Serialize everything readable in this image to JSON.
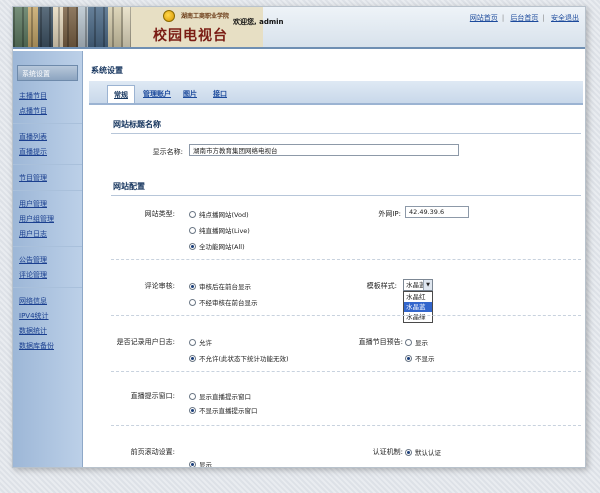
{
  "header": {
    "site_name": "湖南工商职业学院",
    "title": "校园电视台",
    "welcome": "欢迎您, admin",
    "links": [
      "网站首页",
      "后台首页",
      "安全退出"
    ]
  },
  "sidebar": {
    "heading": "系统设置",
    "groups": [
      [
        "主播节目",
        "点播节目"
      ],
      [
        "直播列表",
        "直播提示"
      ],
      [
        "节目管理"
      ],
      [
        "用户管理",
        "用户组管理",
        "用户日志"
      ],
      [
        "公告管理",
        "评论管理"
      ],
      [
        "网络信息",
        "IPV4统计",
        "数据统计",
        "数据库备份"
      ]
    ]
  },
  "main": {
    "title": "系统设置",
    "tabs": [
      "常规",
      "管理账户",
      "图片",
      "接口"
    ],
    "sections": {
      "site_name": "网站标题名称",
      "site_config": "网站配置"
    },
    "fields": {
      "display_name_label": "显示名称:",
      "display_name_value": "湖南市方教育集团网络电视台",
      "site_type_label": "网站类型:",
      "site_type_options": [
        "纯点播网站(Vod)",
        "纯直播网站(Live)",
        "全功能网站(All)"
      ],
      "external_ip_label": "外网IP:",
      "external_ip_value": "42.49.39.6",
      "comment_review_label": "评论审核:",
      "comment_review_options": [
        "审核后在前台显示",
        "不经审核在前台显示"
      ],
      "template_style_label": "模板样式:",
      "template_style_selected": "水晶蓝",
      "template_style_options": [
        "水晶红",
        "水晶蓝",
        "水晶绿"
      ],
      "record_log_label": "是否记录用户日志:",
      "record_log_options": [
        "允许",
        "不允许(此状态下统计功能无效)"
      ],
      "live_prompt_label": "直播节目预告:",
      "live_prompt_options": [
        "显示",
        "不显示"
      ],
      "live_window_label": "直播提示窗口:",
      "live_window_options": [
        "显示直播提示窗口",
        "不显示直播提示窗口"
      ],
      "front_marquee_label": "前页滚动设置:",
      "front_marquee_options": [
        "显示"
      ],
      "auth_label": "认证机制:",
      "auth_options": [
        "默认认证"
      ]
    }
  }
}
